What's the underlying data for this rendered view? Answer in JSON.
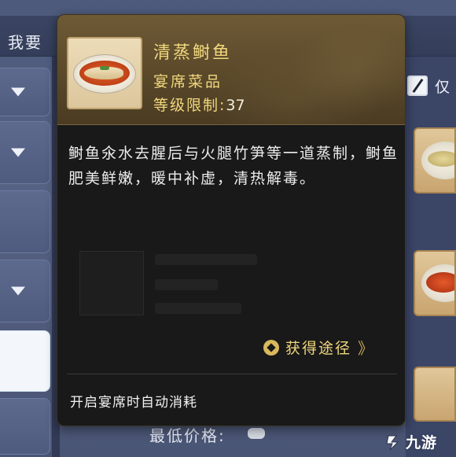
{
  "background": {
    "header_title": "我要",
    "checkbox_label": "仅",
    "bottom_peek_text": "最低价格:"
  },
  "tooltip": {
    "dish_name": "清蒸鲥鱼",
    "category": "宴席菜品",
    "level_label": "等级限制:",
    "level_value": "37",
    "description": "鲥鱼氽水去腥后与火腿竹笋等一道蒸制，鲥鱼肥美鲜嫩，暖中补虚，清热解毒。",
    "obtain_label": "获得途径",
    "obtain_arrow": "》",
    "footer_note": "开启宴席时自动消耗"
  },
  "watermark": {
    "text": "九游"
  },
  "colors": {
    "gold_text": "#f0d77d",
    "tooltip_bg": "#191919",
    "header_bg": "#5c4a2b",
    "page_bg": "#566283"
  },
  "icons": [
    "dish-image",
    "obtain-icon",
    "chevron-down-icon",
    "checkbox",
    "jiuyou-logo"
  ]
}
